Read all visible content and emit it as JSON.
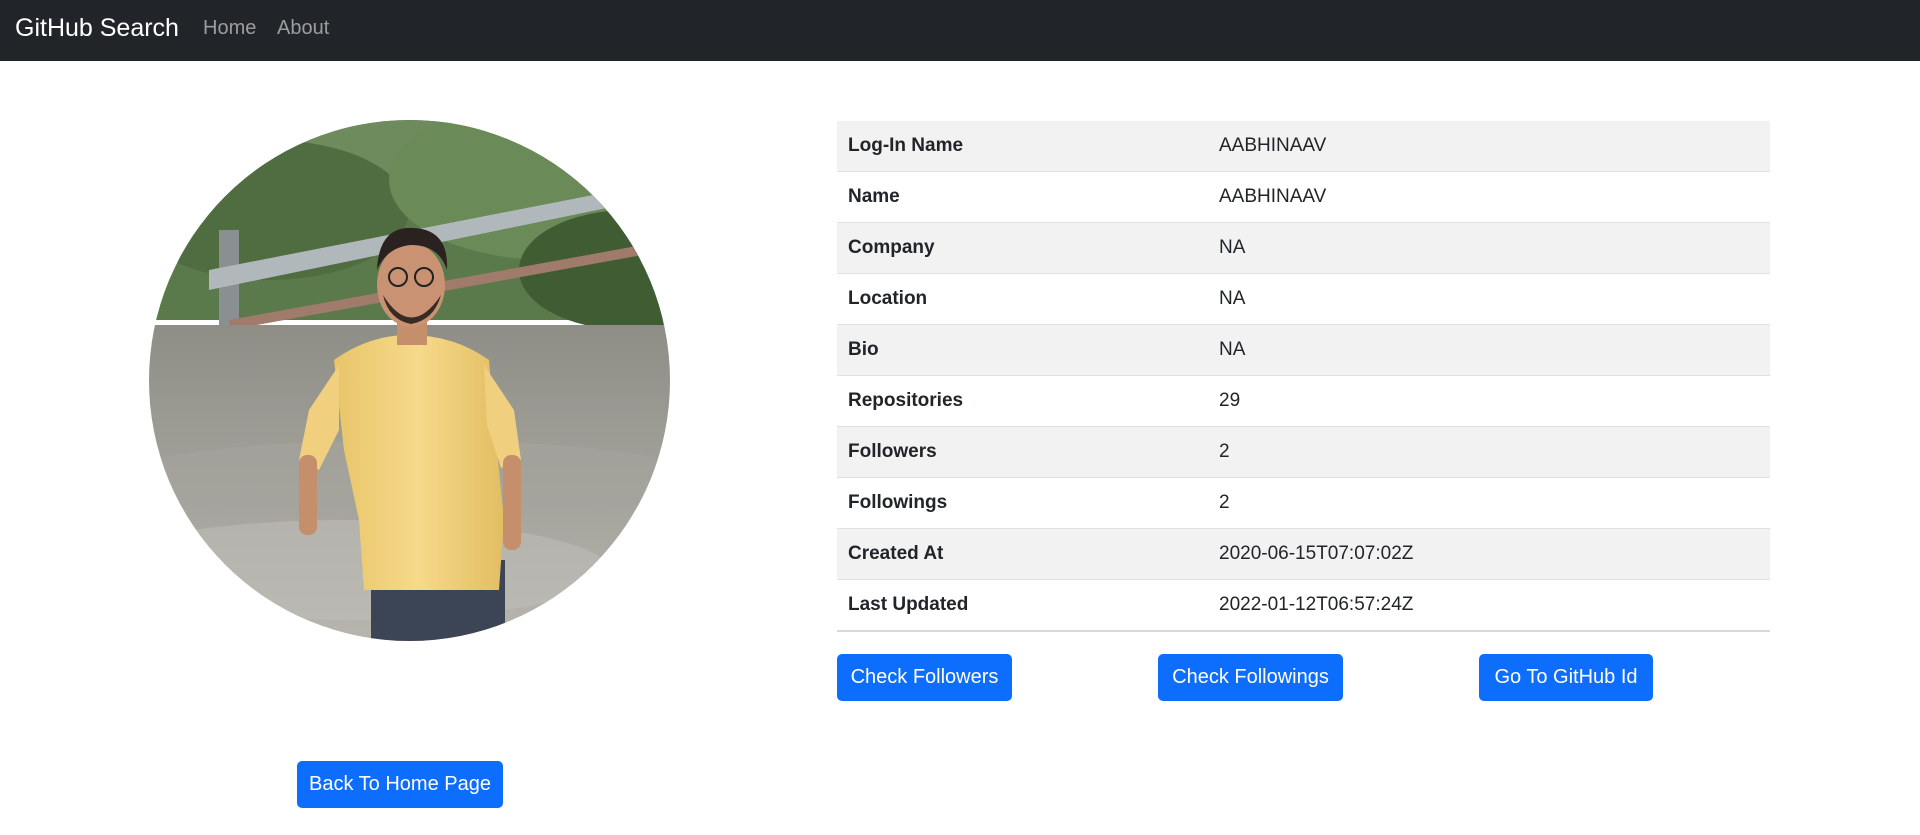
{
  "navbar": {
    "brand": "GitHub Search",
    "links": [
      "Home",
      "About"
    ]
  },
  "profile": {
    "avatar_alt": "profile-photo",
    "back_button": "Back To Home Page"
  },
  "details": [
    {
      "label": "Log-In Name",
      "value": "AABHINAAV"
    },
    {
      "label": "Name",
      "value": "AABHINAAV"
    },
    {
      "label": "Company",
      "value": "NA"
    },
    {
      "label": "Location",
      "value": "NA"
    },
    {
      "label": "Bio",
      "value": "NA"
    },
    {
      "label": "Repositories",
      "value": "29"
    },
    {
      "label": "Followers",
      "value": "2"
    },
    {
      "label": "Followings",
      "value": "2"
    },
    {
      "label": "Created At",
      "value": "2020-06-15T07:07:02Z"
    },
    {
      "label": "Last Updated",
      "value": "2022-01-12T06:57:24Z"
    }
  ],
  "actions": {
    "followers": "Check Followers",
    "followings": "Check Followings",
    "github": "Go To GitHub Id"
  },
  "colors": {
    "navbar_bg": "#212529",
    "primary": "#0d6efd",
    "striped_row": "#f2f2f2"
  }
}
